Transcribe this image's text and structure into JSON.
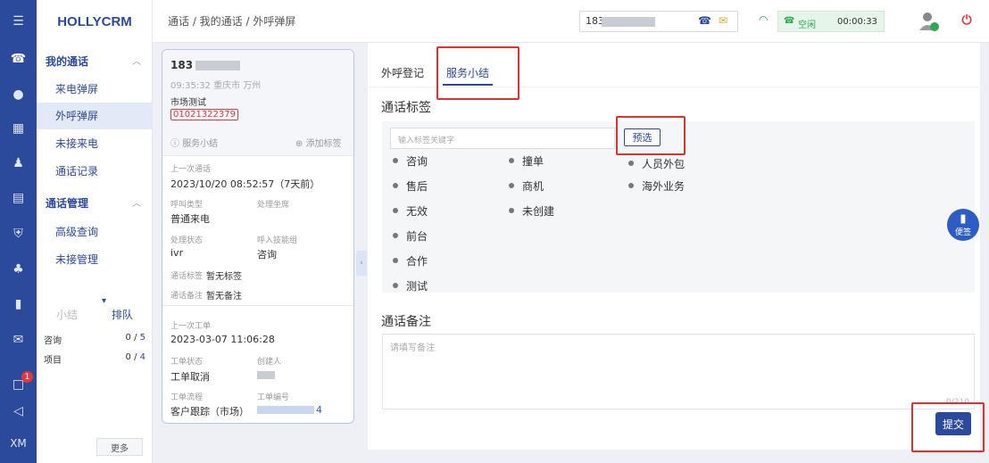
{
  "app": {
    "brand": "HOLLYCRM"
  },
  "rail": {
    "badge": "1",
    "footer": "XM"
  },
  "nav": {
    "group1": "我的通话",
    "items1": [
      "来电弹屏",
      "外呼弹屏",
      "未接来电",
      "通话记录"
    ],
    "group2": "通话管理",
    "items2": [
      "高级查询",
      "未接管理"
    ],
    "tab_summary": "小结",
    "tab_queue": "排队",
    "queue": [
      {
        "label": "咨询",
        "count": "0",
        "total": "5"
      },
      {
        "label": "项目",
        "count": "0",
        "total": "4"
      }
    ],
    "more": "更多"
  },
  "topbar": {
    "breadcrumb": "通话 / 我的通话 / 外呼弹屏",
    "phone_prefix": "183",
    "status": "空闲",
    "timer": "00:00:33"
  },
  "card": {
    "phone": "183",
    "time_loc": "09:35:32 重庆市 万州",
    "name": "市场测试",
    "number_tag": "01021322379",
    "summary_link": "服务小结",
    "add_tag": "添加标签",
    "last_call_label": "上一次通话",
    "last_call_time": "2023/10/20 08:52:57（7天前）",
    "call_type_label": "呼叫类型",
    "call_type": "普通来电",
    "agent_label": "处理坐席",
    "handle_status_label": "处理状态",
    "handle_status": "ivr",
    "skill_label": "呼入技能组",
    "skill": "咨询",
    "call_tag_label": "通话标签",
    "call_tag": "暂无标签",
    "call_remark_label": "通话备注",
    "call_remark": "暂无备注",
    "last_order_label": "上一次工单",
    "last_order_time": "2023-03-07 11:06:28",
    "order_status_label": "工单状态",
    "order_status": "工单取消",
    "creator_label": "创建人",
    "flow_label": "工单流程",
    "flow": "客户跟踪（市场）",
    "order_no_label": "工单编号",
    "order_no_suffix": "4"
  },
  "panel": {
    "tab1": "外呼登记",
    "tab2": "服务小结",
    "tags_title": "通话标签",
    "search_placeholder": "输入标签关键字",
    "preselect": "预选",
    "tags_col1": [
      "咨询",
      "售后",
      "无效",
      "前台",
      "合作",
      "测试"
    ],
    "tags_col2": [
      "撞单",
      "商机",
      "未创建"
    ],
    "tags_col3": [
      "人员外包",
      "海外业务"
    ],
    "remark_title": "通话备注",
    "remark_placeholder": "请填写备注",
    "counter": "0/210",
    "submit": "提交",
    "fab_label": "便签"
  },
  "colors": {
    "primary": "#2c4a9c",
    "highlight": "#e0302a",
    "idle": "#2fa84f"
  }
}
